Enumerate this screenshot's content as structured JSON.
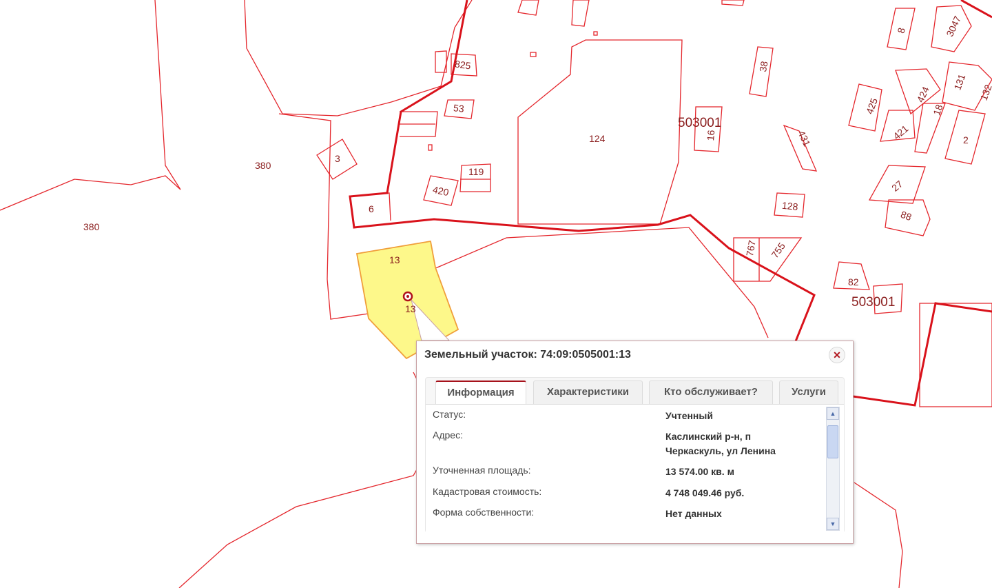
{
  "map": {
    "quarter_labels": [
      "503001",
      "503001"
    ],
    "parcel_labels": [
      "380",
      "380",
      "3",
      "6",
      "13",
      "13",
      "825",
      "53",
      "119",
      "420",
      "124",
      "16",
      "38",
      "431",
      "128",
      "767",
      "755",
      "82",
      "8",
      "3047",
      "425",
      "424",
      "131",
      "132",
      "421",
      "18",
      "2",
      "27",
      "88"
    ],
    "selected_parcel_color": "#fdf88a",
    "boundary_color": "#e4262c"
  },
  "popup": {
    "title": "Земельный участок: 74:09:0505001:13",
    "close_icon": "close-icon",
    "tabs": [
      "Информация",
      "Характеристики",
      "Кто обслуживает?",
      "Услуги"
    ],
    "active_tab": "Информация",
    "rows": [
      {
        "label": "Статус:",
        "value": "Учтенный"
      },
      {
        "label": "Адрес:",
        "value": "Каслинский р-н, п Черкаскуль, ул Ленина"
      },
      {
        "label": "Уточненная площадь:",
        "value": "13 574.00 кв. м"
      },
      {
        "label": "Кадастровая стоимость:",
        "value": "4 748 049.46 руб."
      },
      {
        "label": "Форма собственности:",
        "value": "Нет данных"
      }
    ]
  }
}
